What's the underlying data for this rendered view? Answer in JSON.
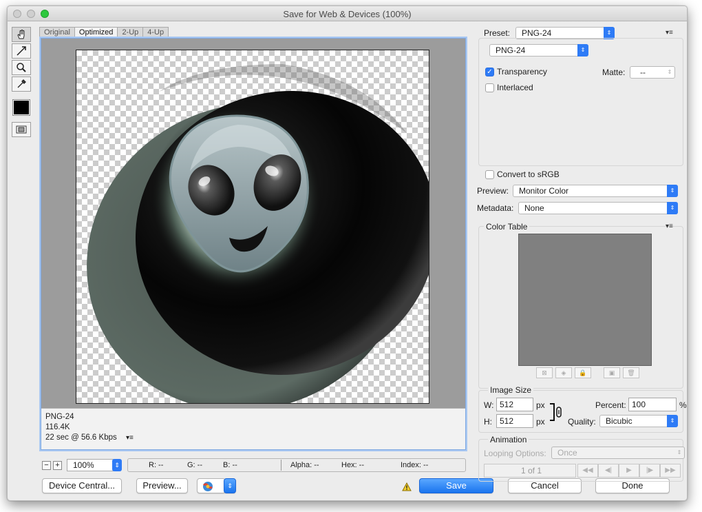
{
  "window": {
    "title": "Save for Web & Devices (100%)"
  },
  "tools": {
    "hand_icon": "hand-icon",
    "slice_icon": "slice-select-icon",
    "zoom_icon": "zoom-icon",
    "eyedropper_icon": "eyedropper-icon",
    "toggle_icon": "slice-visibility-icon",
    "swatch_color": "#000000"
  },
  "tabs": [
    {
      "label": "Original"
    },
    {
      "label": "Optimized"
    },
    {
      "label": "2-Up"
    },
    {
      "label": "4-Up"
    }
  ],
  "preview_info": {
    "format": "PNG-24",
    "size": "116.4K",
    "download": "22 sec @ 56.6 Kbps"
  },
  "statusbar": {
    "zoom_out": "−",
    "zoom_in": "+",
    "zoom": "100%",
    "r": "R: --",
    "g": "G: --",
    "b": "B: --",
    "alpha": "Alpha: --",
    "hex": "Hex: --",
    "index": "Index: --"
  },
  "buttons": {
    "device_central": "Device Central...",
    "preview": "Preview...",
    "save": "Save",
    "cancel": "Cancel",
    "done": "Done"
  },
  "settings": {
    "preset_label": "Preset:",
    "preset_value": "PNG-24",
    "format_value": "PNG-24",
    "transparency_label": "Transparency",
    "transparency_checked": true,
    "interlaced_label": "Interlaced",
    "interlaced_checked": false,
    "matte_label": "Matte:",
    "matte_value": "--",
    "convert_label": "Convert to sRGB",
    "convert_checked": false,
    "preview_label": "Preview:",
    "preview_value": "Monitor Color",
    "metadata_label": "Metadata:",
    "metadata_value": "None",
    "color_table_label": "Color Table",
    "color_table_fill": "#808080"
  },
  "image_size": {
    "section_label": "Image Size",
    "w_label": "W:",
    "w_value": "512",
    "h_label": "H:",
    "h_value": "512",
    "unit": "px",
    "percent_label": "Percent:",
    "percent_value": "100",
    "percent_unit": "%",
    "quality_label": "Quality:",
    "quality_value": "Bicubic"
  },
  "animation": {
    "section_label": "Animation",
    "looping_label": "Looping Options:",
    "looping_value": "Once",
    "frame_counter": "1 of 1"
  },
  "colors": {
    "accent": "#2e7bf6",
    "selection_border": "#7fa8e0"
  }
}
